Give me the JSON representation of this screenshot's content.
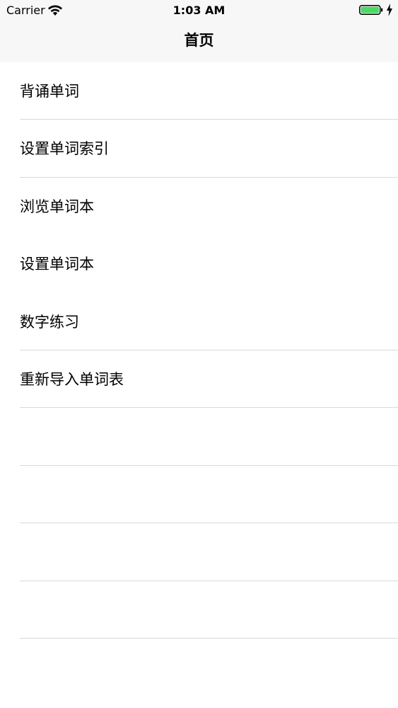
{
  "status_bar": {
    "carrier": "Carrier",
    "time": "1:03 AM",
    "wifi_icon": "wifi-icon",
    "battery_icon": "battery-icon",
    "charging_icon": "bolt-icon",
    "battery_color": "#4cd964"
  },
  "nav": {
    "title": "首页"
  },
  "menu": {
    "items": [
      {
        "label": "背诵单词"
      },
      {
        "label": "设置单词索引"
      },
      {
        "label": "浏览单词本"
      },
      {
        "label": "设置单词本"
      },
      {
        "label": "数字练习"
      },
      {
        "label": "重新导入单词表"
      }
    ]
  }
}
